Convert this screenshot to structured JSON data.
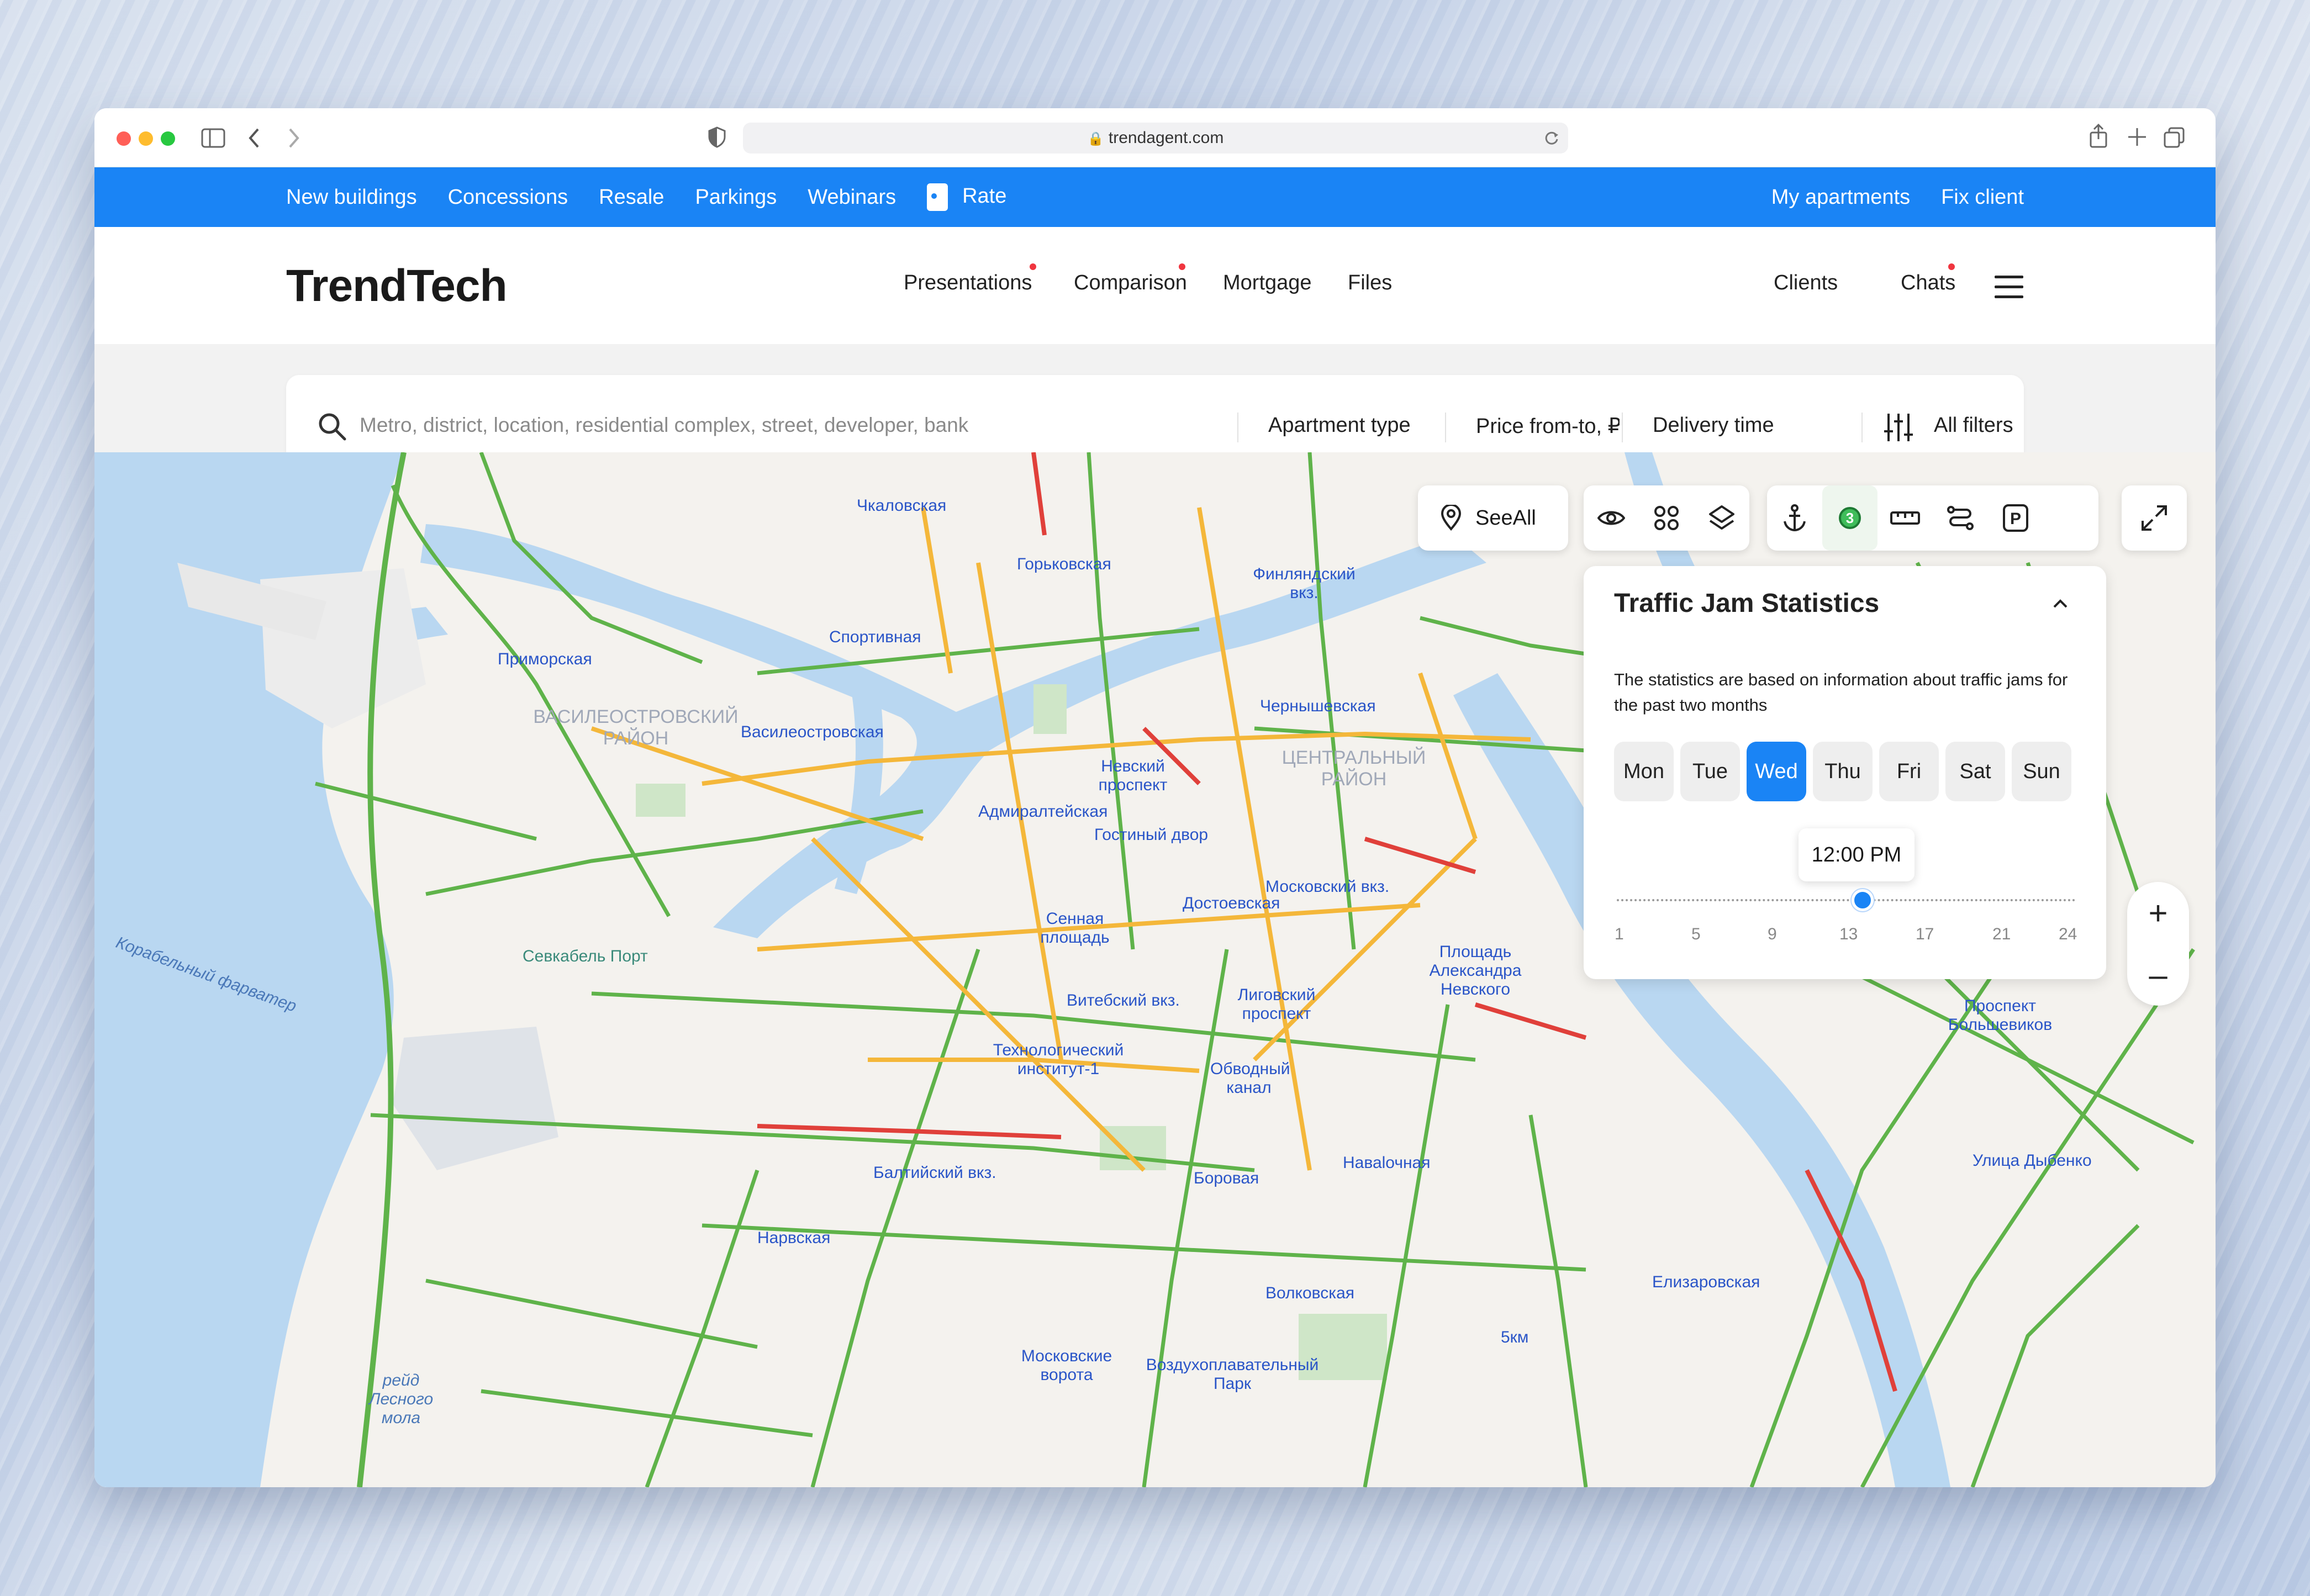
{
  "browser": {
    "url": "trendagent.com"
  },
  "topnav": {
    "left": [
      "New buildings",
      "Concessions",
      "Resale",
      "Parkings",
      "Webinars"
    ],
    "rate": "Rate",
    "right": [
      "My apartments",
      "Fix client"
    ]
  },
  "header": {
    "logo": "TrendTech",
    "nav": [
      "Presentations",
      "Comparison",
      "Mortgage",
      "Files"
    ],
    "right": [
      "Clients",
      "Chats"
    ]
  },
  "search": {
    "placeholder": "Metro, district, location, residential complex, street, developer, bank",
    "apartment_type": "Apartment type",
    "price": "Price from-to, ₽",
    "delivery": "Delivery time",
    "all_filters": "All filters"
  },
  "map_toolbar": {
    "see_all": "SeeAll",
    "badge_count": "3"
  },
  "traffic_panel": {
    "title": "Traffic Jam Statistics",
    "description": "The statistics are based on information about traffic jams for the past two months",
    "days": [
      "Mon",
      "Tue",
      "Wed",
      "Thu",
      "Fri",
      "Sat",
      "Sun"
    ],
    "selected_day": "Wed",
    "time": "12:00 PM",
    "ticks": [
      "1",
      "5",
      "9",
      "13",
      "17",
      "21",
      "24"
    ],
    "slider_hour": 12
  },
  "zoom": {
    "plus": "+",
    "minus": "–"
  },
  "map_labels": {
    "chkalovskaya": "Чкаловская",
    "gorkovskaya": "Горьковская",
    "finlyandsky": "Финляндский вкз.",
    "primorskaya": "Приморская",
    "sportivnaya": "Спортивная",
    "vasileostrovsky": "ВАСИЛЕОСТРОВСКИЙ РАЙОН",
    "vasileostrovskaya": "Василеостровская",
    "chernyshevskaya": "Чернышевская",
    "tsentralny": "ЦЕНТРАЛЬНЫЙ РАЙОН",
    "nevsky": "Невский проспект",
    "admiralteyskaya": "Адмиралтейская",
    "gostiny": "Гостиный двор",
    "moskovsky_vkz": "Московский вкз.",
    "dostoevskaya": "Достоевская",
    "sennaya": "Сенная площадь",
    "ploshchad_nevskogo": "Площадь Александра Невского",
    "sevkabel": "Севкабель Порт",
    "korabelny": "Корабельный фарватер",
    "vitebsky": "Витебский вкз.",
    "ligovsky": "Лиговский проспект",
    "tekhnolog": "Технологический институт-1",
    "obvodny": "Обводный канал",
    "prospekt_bolshevikov": "Проспект Большевиков",
    "baltiysky": "Балтийский вкз.",
    "borovaya": "Боровая",
    "navalochnaya": "Наваlочная",
    "ulitsa_dybenko": "Улица Дыбенко",
    "narvskaya": "Нарвская",
    "elizarovskaya": "Елизаровская",
    "volkovskaya": "Волковская",
    "moskovskie_vorota": "Московские ворота",
    "vozdukhoplav": "Воздухоплавательный Парк",
    "reid": "рейд Лесного мола",
    "5km": "5км"
  }
}
